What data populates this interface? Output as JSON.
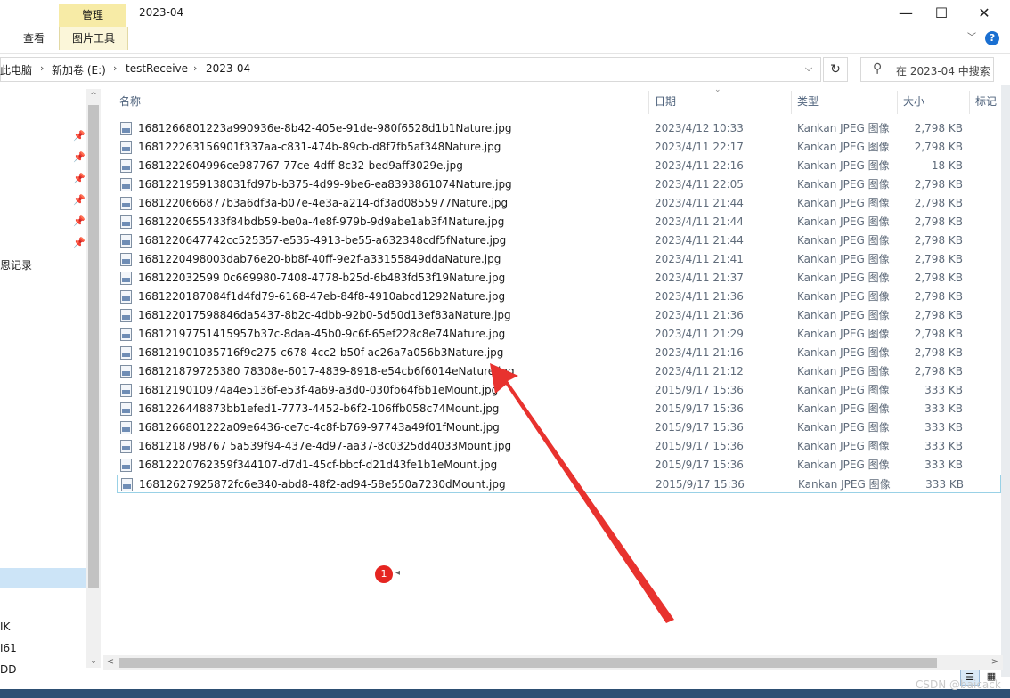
{
  "ribbon": {
    "context_tab": "管理",
    "context_subtab": "图片工具",
    "view_tab": "查看",
    "window_title": "2023-04",
    "minimize_glyph": "—",
    "maximize_glyph": "☐",
    "close_glyph": "✕",
    "collapse_glyph": "﹀",
    "help_glyph": "?"
  },
  "address": {
    "crumbs": [
      "此电脑",
      "新加卷 (E:)",
      "testReceive",
      "2023-04"
    ],
    "separator": "›",
    "dropdown_glyph": "⌵",
    "refresh_glyph": "↻",
    "search_placeholder": "在 2023-04 中搜索"
  },
  "nav": {
    "history_label": "恩记录",
    "bottom_labels": [
      "IK",
      "I61",
      "DD"
    ],
    "pin_glyph": "📌"
  },
  "columns": {
    "name": "名称",
    "date": "日期",
    "type": "类型",
    "size": "大小",
    "tags": "标记",
    "sort_glyph": "⌄"
  },
  "files": [
    {
      "name": "1681266801223a990936e-8b42-405e-91de-980f6528d1b1Nature.jpg",
      "date": "2023/4/12 10:33",
      "type": "Kankan JPEG 图像",
      "size": "2,798 KB"
    },
    {
      "name": "168122263156901f337aa-c831-474b-89cb-d8f7fb5af348Nature.jpg",
      "date": "2023/4/11 22:17",
      "type": "Kankan JPEG 图像",
      "size": "2,798 KB"
    },
    {
      "name": "1681222604996ce987767-77ce-4dff-8c32-bed9aff3029e.jpg",
      "date": "2023/4/11 22:16",
      "type": "Kankan JPEG 图像",
      "size": "18 KB"
    },
    {
      "name": "1681221959138031fd97b-b375-4d99-9be6-ea8393861074Nature.jpg",
      "date": "2023/4/11 22:05",
      "type": "Kankan JPEG 图像",
      "size": "2,798 KB"
    },
    {
      "name": "1681220666877b3a6df3a-b07e-4e3a-a214-df3ad0855977Nature.jpg",
      "date": "2023/4/11 21:44",
      "type": "Kankan JPEG 图像",
      "size": "2,798 KB"
    },
    {
      "name": "1681220655433f84bdb59-be0a-4e8f-979b-9d9abe1ab3f4Nature.jpg",
      "date": "2023/4/11 21:44",
      "type": "Kankan JPEG 图像",
      "size": "2,798 KB"
    },
    {
      "name": "1681220647742cc525357-e535-4913-be55-a632348cdf5fNature.jpg",
      "date": "2023/4/11 21:44",
      "type": "Kankan JPEG 图像",
      "size": "2,798 KB"
    },
    {
      "name": "1681220498003dab76e20-bb8f-40ff-9e2f-a33155849ddaNature.jpg",
      "date": "2023/4/11 21:41",
      "type": "Kankan JPEG 图像",
      "size": "2,798 KB"
    },
    {
      "name": "168122032599 0c669980-7408-4778-b25d-6b483fd53f19Nature.jpg",
      "date": "2023/4/11 21:37",
      "type": "Kankan JPEG 图像",
      "size": "2,798 KB"
    },
    {
      "name": "1681220187084f1d4fd79-6168-47eb-84f8-4910abcd1292Nature.jpg",
      "date": "2023/4/11 21:36",
      "type": "Kankan JPEG 图像",
      "size": "2,798 KB"
    },
    {
      "name": "168122017598846da5437-8b2c-4dbb-92b0-5d50d13ef83aNature.jpg",
      "date": "2023/4/11 21:36",
      "type": "Kankan JPEG 图像",
      "size": "2,798 KB"
    },
    {
      "name": "16812197751415957b37c-8daa-45b0-9c6f-65ef228c8e74Nature.jpg",
      "date": "2023/4/11 21:29",
      "type": "Kankan JPEG 图像",
      "size": "2,798 KB"
    },
    {
      "name": "168121901035716f9c275-c678-4cc2-b50f-ac26a7a056b3Nature.jpg",
      "date": "2023/4/11 21:16",
      "type": "Kankan JPEG 图像",
      "size": "2,798 KB"
    },
    {
      "name": "168121879725380 78308e-6017-4839-8918-e54cb6f6014eNature.jpg",
      "date": "2023/4/11 21:12",
      "type": "Kankan JPEG 图像",
      "size": "2,798 KB"
    },
    {
      "name": "1681219010974a4e5136f-e53f-4a69-a3d0-030fb64f6b1eMount.jpg",
      "date": "2015/9/17 15:36",
      "type": "Kankan JPEG 图像",
      "size": "333 KB"
    },
    {
      "name": "1681226448873bb1efed1-7773-4452-b6f2-106ffb058c74Mount.jpg",
      "date": "2015/9/17 15:36",
      "type": "Kankan JPEG 图像",
      "size": "333 KB"
    },
    {
      "name": "1681266801222a09e6436-ce7c-4c8f-b769-97743a49f01fMount.jpg",
      "date": "2015/9/17 15:36",
      "type": "Kankan JPEG 图像",
      "size": "333 KB"
    },
    {
      "name": "1681218798767 5a539f94-437e-4d97-aa37-8c0325dd4033Mount.jpg",
      "date": "2015/9/17 15:36",
      "type": "Kankan JPEG 图像",
      "size": "333 KB"
    },
    {
      "name": "16812220762359f344107-d7d1-45cf-bbcf-d21d43fe1b1eMount.jpg",
      "date": "2015/9/17 15:36",
      "type": "Kankan JPEG 图像",
      "size": "333 KB"
    },
    {
      "name": "16812627925872fc6e340-abd8-48f2-ad94-58e550a7230dMount.jpg",
      "date": "2015/9/17 15:36",
      "type": "Kankan JPEG 图像",
      "size": "333 KB"
    }
  ],
  "badge": {
    "count": "1",
    "caret": "◂"
  },
  "scroll": {
    "left_glyph": "<",
    "right_glyph": ">",
    "up_glyph": "^",
    "down_glyph": "⌄"
  },
  "status": {
    "view_details_glyph": "☰",
    "view_tiles_glyph": "▦",
    "watermark": "CSDN @baicack"
  },
  "colors": {
    "accent_arrow": "#e8322e",
    "selection": "#cce4f7",
    "context_tab": "#f7eba6"
  }
}
